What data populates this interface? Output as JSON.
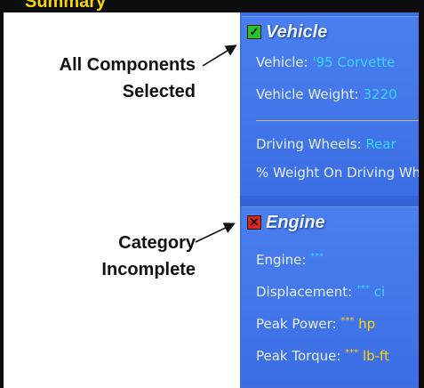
{
  "top_bar": {
    "title": "Summary"
  },
  "annotations": {
    "all_selected": [
      "All Components",
      "Selected"
    ],
    "incomplete": [
      "Category",
      "Incomplete"
    ]
  },
  "vehicle": {
    "title": "Vehicle",
    "status": "checked",
    "check_glyph": "✓",
    "rows": {
      "vehicle_label": "Vehicle:",
      "vehicle_value": "'95 Corvette",
      "weight_label": "Vehicle Weight:",
      "weight_value": "3220",
      "driving_wheels_label": "Driving Wheels:",
      "driving_wheels_value": "Rear",
      "weight_on_driving_label": "% Weight On Driving Wheels"
    }
  },
  "engine": {
    "title": "Engine",
    "status": "incomplete",
    "check_glyph": "✕",
    "rows": {
      "engine_label": "Engine:",
      "engine_value": "***",
      "displacement_label": "Displacement:",
      "displacement_stars": "***",
      "displacement_unit": "ci",
      "power_label": "Peak Power:",
      "power_stars": "***",
      "power_unit": "hp",
      "torque_label": "Peak Torque:",
      "torque_stars": "***",
      "torque_unit": "lb-ft"
    }
  },
  "colors": {
    "panel": "#3f6ee0",
    "value_cyan": "#39d6ff",
    "value_yellow": "#ffd400",
    "check_green": "#22c72a",
    "check_red": "#e0211f"
  }
}
